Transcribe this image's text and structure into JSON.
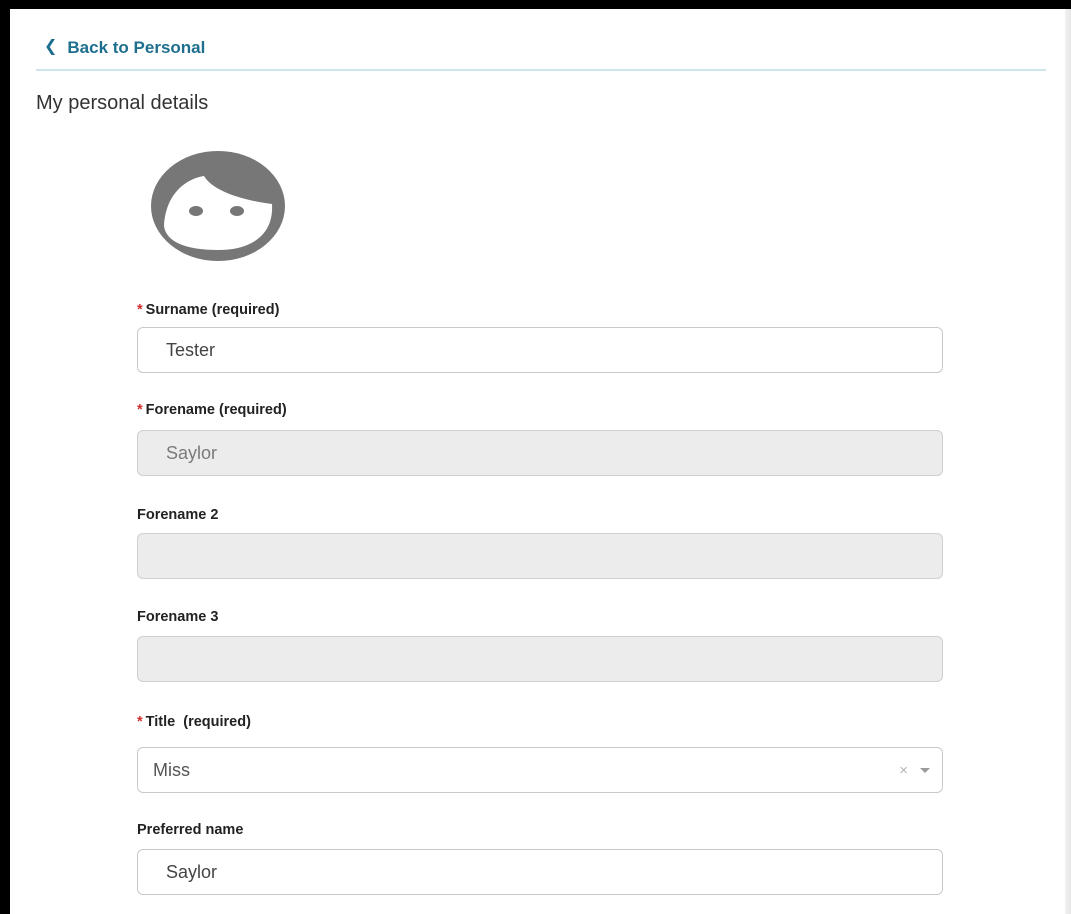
{
  "nav": {
    "back_label": "Back to Personal",
    "back_icon": "chevron-left-icon"
  },
  "page": {
    "title": "My personal details"
  },
  "avatar": {
    "icon": "user-face-icon",
    "color": "#777777"
  },
  "form": {
    "surname": {
      "label": "Surname (required)",
      "required": true,
      "value": "Tester",
      "disabled": false
    },
    "forename": {
      "label": "Forename (required)",
      "required": true,
      "value": "Saylor",
      "disabled": true
    },
    "forename2": {
      "label": "Forename 2",
      "required": false,
      "value": "",
      "disabled": true
    },
    "forename3": {
      "label": "Forename 3",
      "required": false,
      "value": "",
      "disabled": true
    },
    "title": {
      "label": "Title  (required)",
      "required": true,
      "selected": "Miss",
      "clear_icon": "×"
    },
    "preferred_name": {
      "label": "Preferred name",
      "required": false,
      "value": "Saylor",
      "disabled": false
    }
  },
  "colors": {
    "link": "#1e6f8f",
    "required_marker": "#d12c2c",
    "divider": "#cfe5ec",
    "disabled_bg": "#ececec"
  },
  "required_marker": "*"
}
